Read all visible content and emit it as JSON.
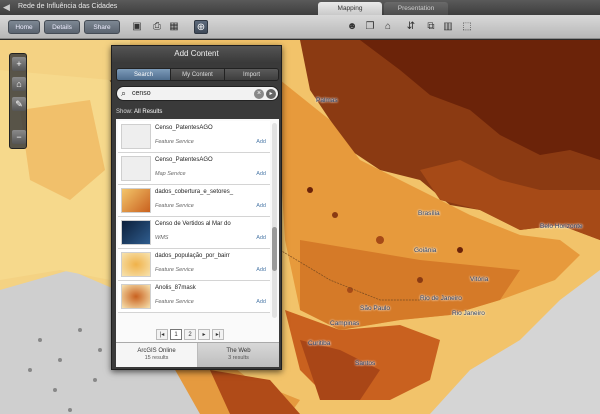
{
  "window": {
    "title": "Rede de Influência das Cidades",
    "mode_tabs": [
      {
        "label": "Mapping",
        "active": true
      },
      {
        "label": "Presentation",
        "active": false
      }
    ]
  },
  "toolbar": {
    "home_label": "Home",
    "details_label": "Details",
    "share_label": "Share"
  },
  "map": {
    "cities": [
      "Palmas",
      "Brasília",
      "Goiânia",
      "Belo Horizonte",
      "Vitória",
      "Rio de Janeiro",
      "São Paulo",
      "Campinas",
      "Curitiba",
      "Rio Janeiro",
      "Santos"
    ]
  },
  "add_content": {
    "title": "Add Content",
    "segments": [
      {
        "label": "Search",
        "active": true
      },
      {
        "label": "My Content",
        "active": false
      },
      {
        "label": "Import",
        "active": false
      }
    ],
    "search_value": "censo",
    "show_label": "Show:",
    "show_value": "All Results",
    "results": [
      {
        "name": "Censo_PatentesAGO",
        "type": "Feature Service",
        "add": "Add",
        "thumb": "blank"
      },
      {
        "name": "Censo_PatentesAGO",
        "type": "Map Service",
        "add": "Add",
        "thumb": "blank"
      },
      {
        "name": "dados_cobertura_e_setores_",
        "type": "Feature Service",
        "add": "Add",
        "thumb": "orange-map"
      },
      {
        "name": "Censo de Vertidos al Mar do",
        "type": "WMS",
        "add": "Add",
        "thumb": "dark-map"
      },
      {
        "name": "dados_população_por_bairr",
        "type": "Feature Service",
        "add": "Add",
        "thumb": "orange-map"
      },
      {
        "name": "Anolis_87mask",
        "type": "Feature Service",
        "add": "Add",
        "thumb": "red-map"
      }
    ],
    "pager": [
      "|◂",
      "1",
      "2",
      "▸",
      "▸|"
    ],
    "sources": [
      {
        "label": "ArcGIS Online",
        "count": "15 results"
      },
      {
        "label": "The Web",
        "count": "3 results"
      }
    ]
  }
}
